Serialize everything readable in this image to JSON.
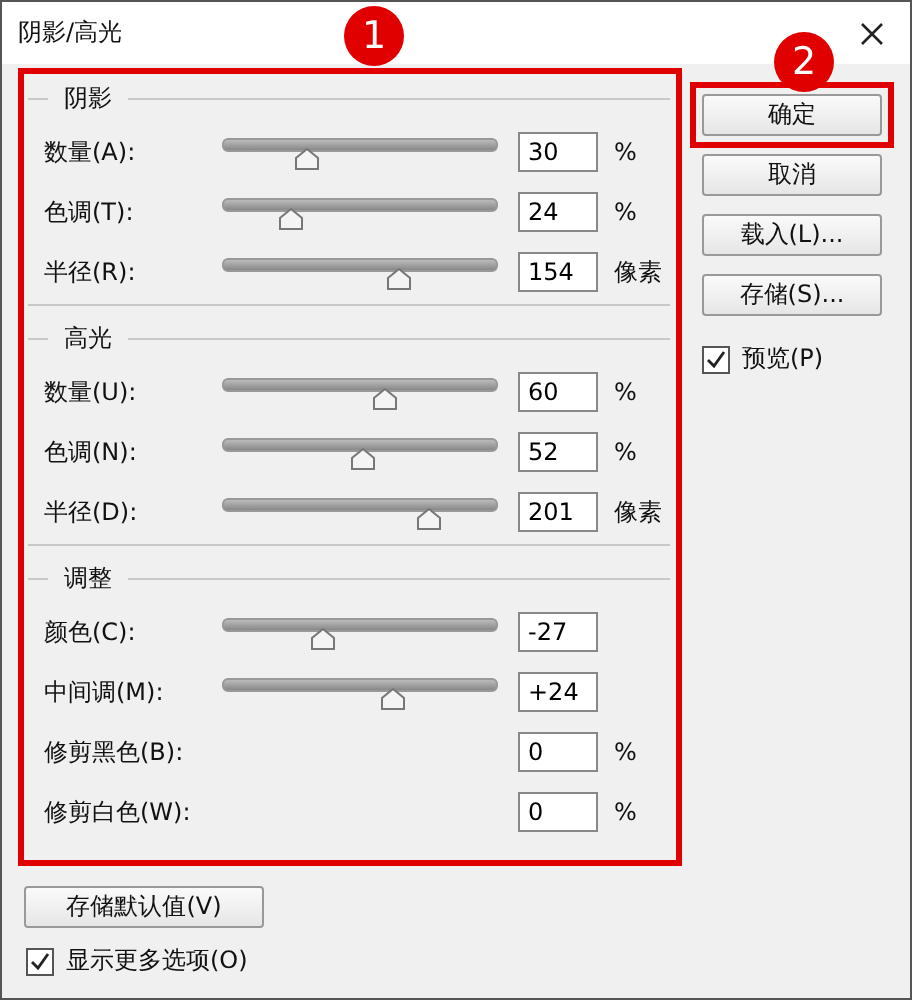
{
  "window": {
    "title": "阴影/高光"
  },
  "annotations": [
    {
      "label": "1"
    },
    {
      "label": "2"
    }
  ],
  "sections": [
    {
      "title": "阴影",
      "rows": [
        {
          "kind": "slider",
          "label": "数量(A):",
          "value": "30",
          "unit": "%",
          "level": 0.3
        },
        {
          "kind": "slider",
          "label": "色调(T):",
          "value": "24",
          "unit": "%",
          "level": 0.24
        },
        {
          "kind": "slider",
          "label": "半径(R):",
          "value": "154",
          "unit": "像素",
          "level": 0.64
        }
      ]
    },
    {
      "title": "高光",
      "rows": [
        {
          "kind": "slider",
          "label": "数量(U):",
          "value": "60",
          "unit": "%",
          "level": 0.59
        },
        {
          "kind": "slider",
          "label": "色调(N):",
          "value": "52",
          "unit": "%",
          "level": 0.51
        },
        {
          "kind": "slider",
          "label": "半径(D):",
          "value": "201",
          "unit": "像素",
          "level": 0.75
        }
      ]
    },
    {
      "title": "调整",
      "rows": [
        {
          "kind": "slider",
          "label": "颜色(C):",
          "value": "-27",
          "level": 0.36
        },
        {
          "kind": "slider",
          "label": "中间调(M):",
          "value": "+24",
          "level": 0.62
        },
        {
          "kind": "field",
          "label": "修剪黑色(B):",
          "value": "0",
          "unit": "%"
        },
        {
          "kind": "field",
          "label": "修剪白色(W):",
          "value": "0",
          "unit": "%"
        }
      ]
    }
  ],
  "buttons": [
    {
      "label": "确定",
      "highlighted": true
    },
    {
      "label": "取消",
      "highlighted": false
    },
    {
      "label": "载入(L)...",
      "highlighted": false
    },
    {
      "label": "存储(S)...",
      "highlighted": false
    }
  ],
  "preview": {
    "label": "预览(P)",
    "checked": true
  },
  "save_defaults_button": "存储默认值(V)",
  "more_options": {
    "label": "显示更多选项(O)",
    "checked": true
  }
}
